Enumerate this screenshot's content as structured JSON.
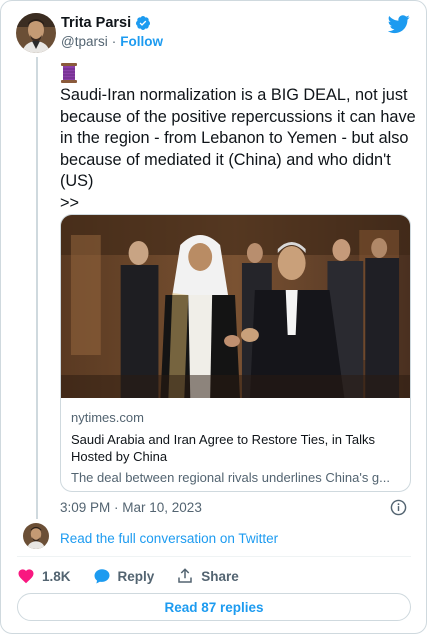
{
  "author": {
    "name": "Trita Parsi",
    "handle": "@tparsi",
    "separator": "·",
    "follow_label": "Follow"
  },
  "tweet": {
    "text": "Saudi-Iran normalization is a BIG DEAL, not just because of the positive repercussions it can have in the region - from Lebanon to Yemen - but also because of mediated it (China) and who didn't (US)\n>>",
    "emoji": "thread-spool-emoji",
    "timestamp": "3:09 PM · Mar 10, 2023"
  },
  "link_card": {
    "domain": "nytimes.com",
    "title": "Saudi Arabia and Iran Agree to Restore Ties, in Talks Hosted by China",
    "description": "The deal between regional rivals underlines China's g..."
  },
  "conversation": {
    "label": "Read the full conversation on Twitter"
  },
  "actions": {
    "likes": "1.8K",
    "reply_label": "Reply",
    "share_label": "Share"
  },
  "replies_button": {
    "label": "Read 87 replies"
  },
  "colors": {
    "accent": "#1d9bf0",
    "like": "#f91880",
    "text": "#0f1419",
    "secondary": "#536471",
    "border": "#cfd9de"
  },
  "icons": [
    "verified-badge-icon",
    "twitter-bird-icon",
    "info-icon",
    "heart-icon",
    "reply-bubble-icon",
    "share-icon"
  ]
}
